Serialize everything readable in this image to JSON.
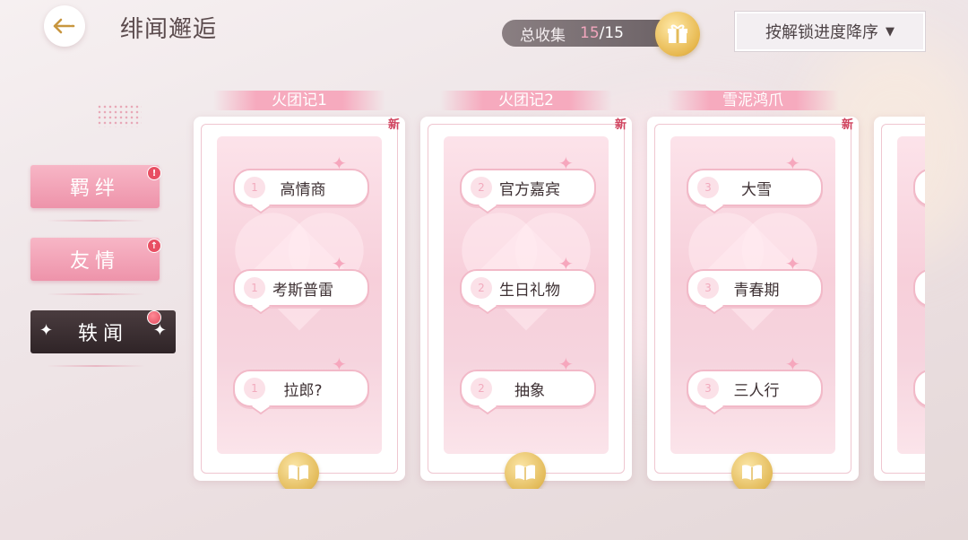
{
  "header": {
    "title": "绯闻邂逅",
    "collect_label": "总收集",
    "collect_current": "15",
    "collect_total": "/15",
    "sort_label": "按解锁进度降序",
    "sort_caret": "▼"
  },
  "sidebar": {
    "items": [
      {
        "label": "羁绊",
        "badge": "!"
      },
      {
        "label": "友情",
        "badge": "↑"
      },
      {
        "label": "轶闻",
        "badge": ""
      }
    ]
  },
  "columns": [
    {
      "title": "火团记1",
      "new": "新",
      "bubbles": [
        {
          "num": "1",
          "label": "高情商"
        },
        {
          "num": "1",
          "label": "考斯普雷"
        },
        {
          "num": "1",
          "label": "拉郎?"
        }
      ]
    },
    {
      "title": "火团记2",
      "new": "新",
      "bubbles": [
        {
          "num": "2",
          "label": "官方嘉宾"
        },
        {
          "num": "2",
          "label": "生日礼物"
        },
        {
          "num": "2",
          "label": "抽象"
        }
      ]
    },
    {
      "title": "雪泥鸿爪",
      "new": "新",
      "bubbles": [
        {
          "num": "3",
          "label": "大雪"
        },
        {
          "num": "3",
          "label": "青春期"
        },
        {
          "num": "3",
          "label": "三人行"
        }
      ]
    }
  ],
  "icons": {
    "back": "back-arrow-icon",
    "gift": "gift-icon",
    "book": "book-icon",
    "sparkle": "sparkle-icon"
  },
  "colors": {
    "accent_pink": "#f6aabe",
    "badge_red": "#e84f63",
    "gold": "#e3bb5a"
  }
}
